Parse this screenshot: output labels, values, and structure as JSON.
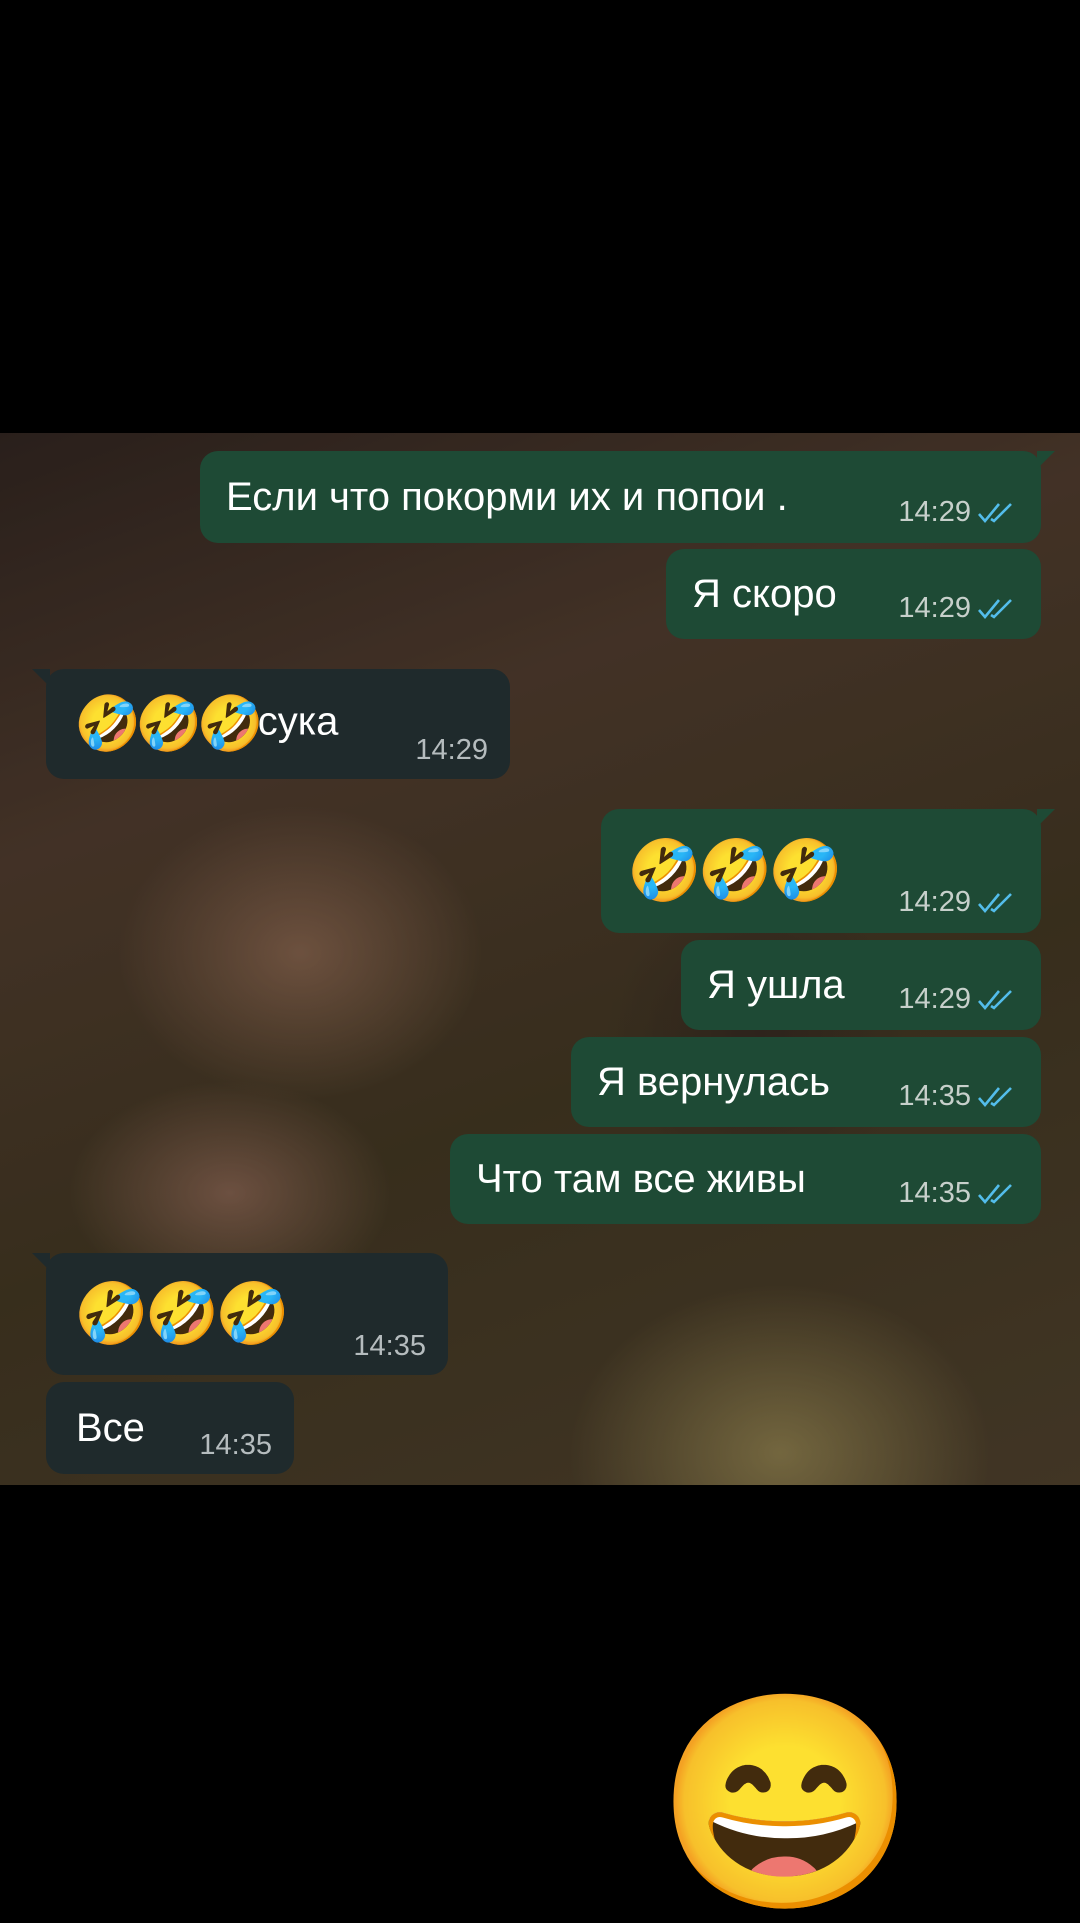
{
  "messages": [
    {
      "text": "Если что покорми их и попои .",
      "time": "14:29",
      "direction": "outgoing",
      "read": true
    },
    {
      "text": "Я скоро",
      "time": "14:29",
      "direction": "outgoing",
      "read": true
    },
    {
      "emoji": "🤣🤣🤣",
      "text": "сука",
      "time": "14:29",
      "direction": "incoming"
    },
    {
      "emoji": "🤣🤣🤣",
      "time": "14:29",
      "direction": "outgoing",
      "read": true
    },
    {
      "text": "Я ушла",
      "time": "14:29",
      "direction": "outgoing",
      "read": true
    },
    {
      "text": "Я вернулась",
      "time": "14:35",
      "direction": "outgoing",
      "read": true
    },
    {
      "text": "Что там все живы",
      "time": "14:35",
      "direction": "outgoing",
      "read": true
    },
    {
      "emoji": "🤣🤣🤣",
      "time": "14:35",
      "direction": "incoming"
    },
    {
      "text": "Все",
      "time": "14:35",
      "direction": "incoming"
    }
  ],
  "overlay": {
    "emoji": "😄",
    "icon": "grinning-face-icon"
  },
  "colors": {
    "outgoing_bubble": "#1e4a35",
    "incoming_bubble": "#1f2a2c",
    "read_ticks": "#53bdeb"
  }
}
